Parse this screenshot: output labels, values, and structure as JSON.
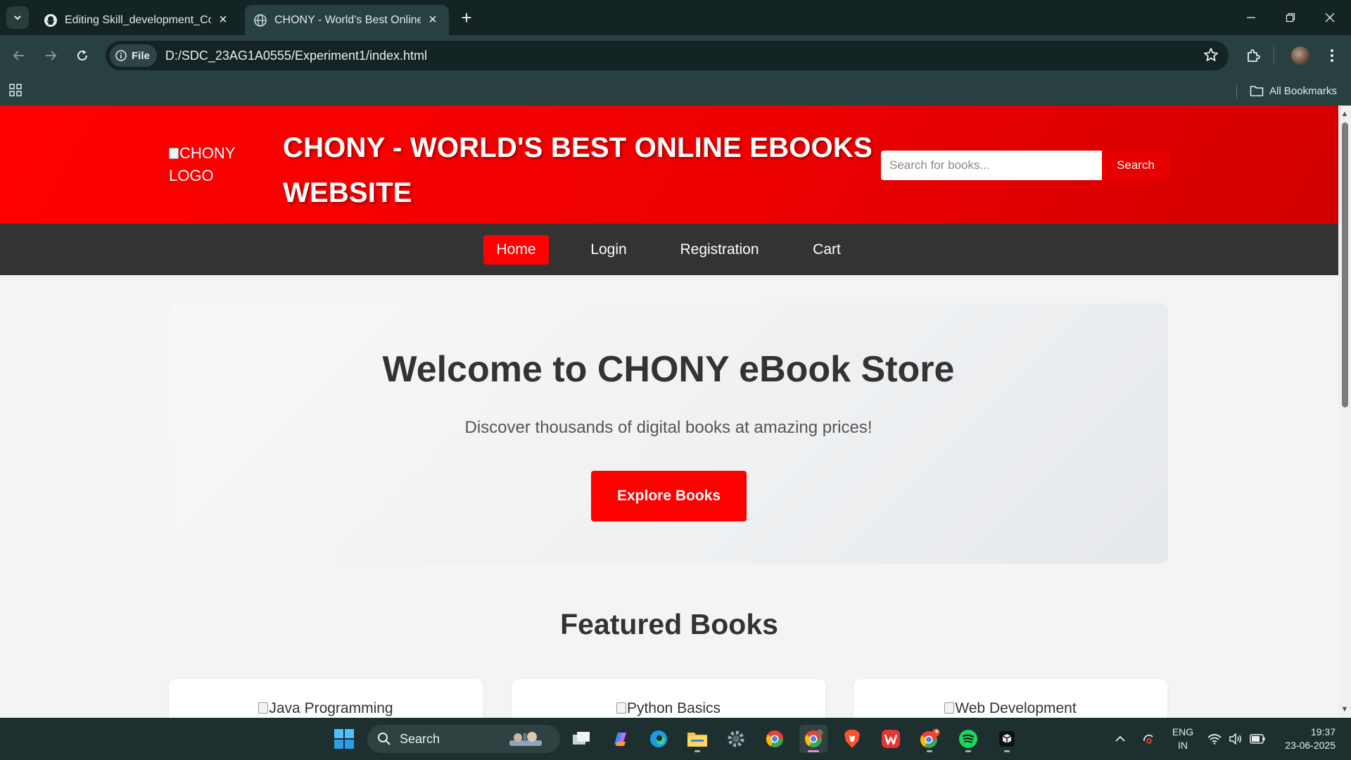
{
  "browser": {
    "tabs": [
      {
        "title": "Editing Skill_development_Cour",
        "active": false
      },
      {
        "title": "CHONY - World's Best Online e",
        "active": true
      }
    ],
    "url_chip": "File",
    "url": "D:/SDC_23AG1A0555/Experiment1/index.html",
    "all_bookmarks": "All Bookmarks"
  },
  "site": {
    "logo_alt": "CHONY LOGO",
    "title": "CHONY - WORLD'S BEST ONLINE EBOOKS WEBSITE",
    "search": {
      "placeholder": "Search for books...",
      "button": "Search"
    },
    "nav": [
      {
        "label": "Home",
        "active": true
      },
      {
        "label": "Login",
        "active": false
      },
      {
        "label": "Registration",
        "active": false
      },
      {
        "label": "Cart",
        "active": false
      }
    ],
    "hero": {
      "title": "Welcome to CHONY eBook Store",
      "subtitle": "Discover thousands of digital books at amazing prices!",
      "cta": "Explore Books"
    },
    "featured": {
      "title": "Featured Books",
      "books": [
        {
          "image_alt": "Java Programming"
        },
        {
          "image_alt": "Python Basics"
        },
        {
          "image_alt": "Web Development"
        }
      ]
    },
    "colors": {
      "primary": "#ff0000",
      "nav_bg": "#333333",
      "page_bg": "#f4f4f4"
    }
  },
  "taskbar": {
    "search_label": "Search",
    "language": {
      "line1": "ENG",
      "line2": "IN"
    },
    "clock": {
      "time": "19:37",
      "date": "23-06-2025"
    },
    "badge": "e"
  }
}
